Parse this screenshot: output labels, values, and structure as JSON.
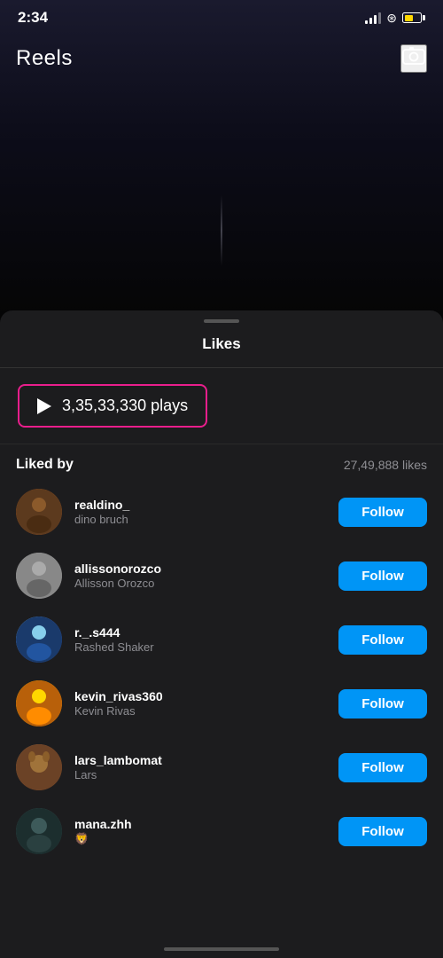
{
  "statusBar": {
    "time": "2:34",
    "signalLabel": "signal",
    "wifiLabel": "wifi",
    "batteryLabel": "battery"
  },
  "topBar": {
    "title": "Reels",
    "cameraLabel": "camera"
  },
  "sheet": {
    "title": "Likes",
    "handleLabel": "sheet-handle",
    "playsCount": "3,35,33,330 plays",
    "likedByLabel": "Liked by",
    "likesCount": "27,49,888 likes"
  },
  "users": [
    {
      "username": "realdino_",
      "displayName": "dino bruch",
      "followLabel": "Follow",
      "avatarClass": "avatar-1",
      "avatarEmoji": "🧍"
    },
    {
      "username": "allissonorozco",
      "displayName": "Allisson Orozco",
      "followLabel": "Follow",
      "avatarClass": "avatar-2",
      "avatarEmoji": "🧍"
    },
    {
      "username": "r._.s444",
      "displayName": "Rashed Shaker",
      "followLabel": "Follow",
      "avatarClass": "avatar-3",
      "avatarEmoji": "🧍"
    },
    {
      "username": "kevin_rivas360",
      "displayName": "Kevin Rivas",
      "followLabel": "Follow",
      "avatarClass": "avatar-4",
      "avatarEmoji": "🧍"
    },
    {
      "username": "lars_lambomat",
      "displayName": "Lars",
      "followLabel": "Follow",
      "avatarClass": "avatar-5",
      "avatarEmoji": "🐕"
    },
    {
      "username": "mana.zhh",
      "displayName": "🦁",
      "followLabel": "Follow",
      "avatarClass": "avatar-6",
      "avatarEmoji": "👤"
    }
  ]
}
